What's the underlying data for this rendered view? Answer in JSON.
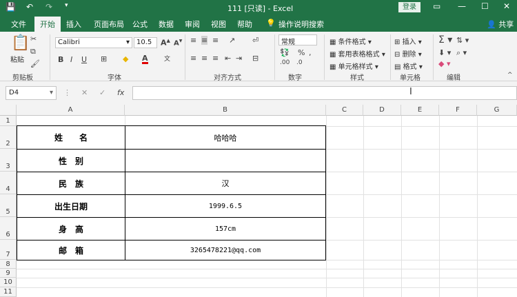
{
  "titlebar": {
    "title": "111 [只读] - Excel",
    "login": "登录",
    "save_icon": "save-icon",
    "undo": "↶",
    "redo": "↷"
  },
  "tabs": [
    "文件",
    "开始",
    "插入",
    "页面布局",
    "公式",
    "数据",
    "审阅",
    "视图",
    "帮助",
    "操作说明搜索"
  ],
  "share": "共享",
  "ribbon": {
    "paste": "粘贴",
    "clipboard": "剪贴板",
    "font_name": "Calibri",
    "font_size": "10.5",
    "font_group": "字体",
    "align_group": "对齐方式",
    "number_format": "常规",
    "number_group": "数字",
    "cond_format": "条件格式",
    "table_format": "套用表格格式",
    "cell_style": "单元格样式",
    "style_group": "样式",
    "insert": "插入",
    "delete": "删除",
    "format": "格式",
    "cells_group": "单元格",
    "edit_group": "编辑"
  },
  "formula_bar": {
    "name_box": "D4",
    "fx": "fx",
    "value": ""
  },
  "columns": [
    "A",
    "B",
    "C",
    "D",
    "E",
    "F",
    "G"
  ],
  "rows": [
    "1",
    "2",
    "3",
    "4",
    "5",
    "6",
    "7",
    "8",
    "9",
    "10",
    "11"
  ],
  "table": [
    {
      "label": "姓　　名",
      "value": "哈哈哈"
    },
    {
      "label": "性　别",
      "value": ""
    },
    {
      "label": "民　族",
      "value": "汉"
    },
    {
      "label": "出生日期",
      "value": "1999.6.5"
    },
    {
      "label": "身　高",
      "value": "157cm"
    },
    {
      "label": "邮　箱",
      "value": "3265478221@qq.com"
    }
  ]
}
